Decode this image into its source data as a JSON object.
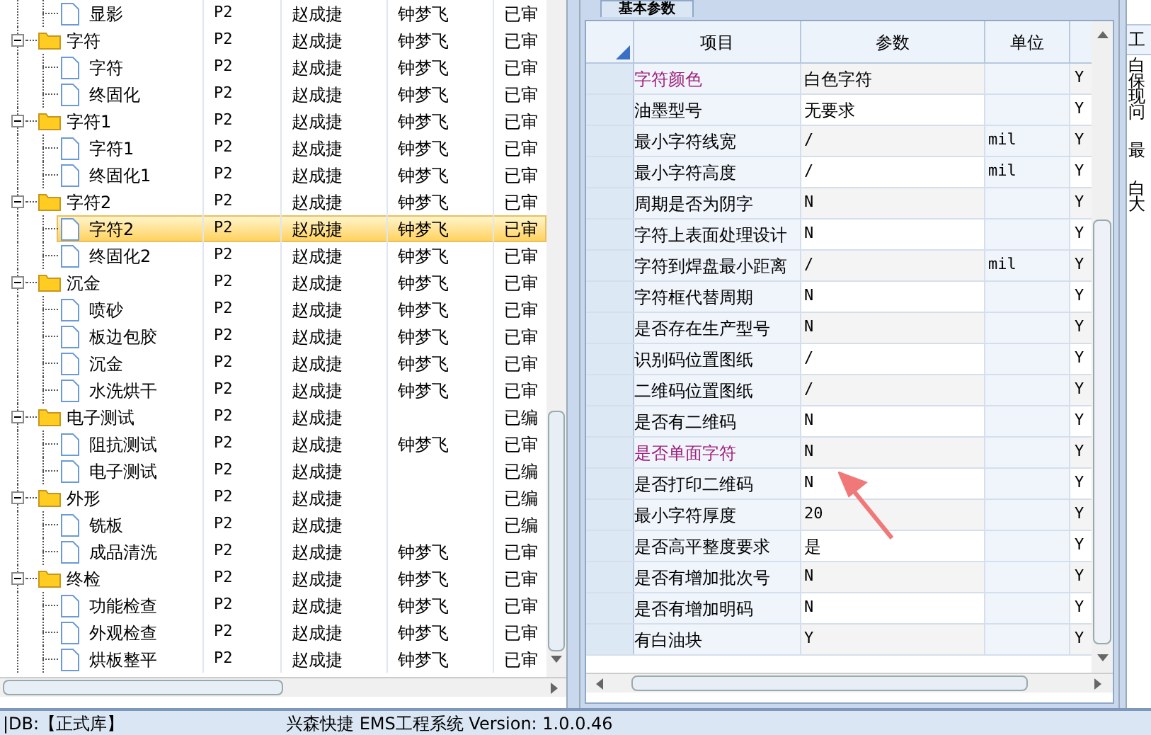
{
  "tree": {
    "nodes": [
      {
        "children": [
          {
            "label": "显影",
            "kind": "file",
            "selected": false,
            "cells": {
              "column_2": "P2",
              "column_3": "赵成捷",
              "column_4": "钟梦飞",
              "column_5": "已审"
            }
          }
        ]
      },
      {
        "label": "字符",
        "kind": "folder",
        "expanded": true,
        "selected": false,
        "cells": {
          "column_2": "P2",
          "column_3": "赵成捷",
          "column_4": "钟梦飞",
          "column_5": "已审"
        },
        "children": [
          {
            "label": "字符",
            "kind": "file",
            "selected": false,
            "cells": {
              "column_2": "P2",
              "column_3": "赵成捷",
              "column_4": "钟梦飞",
              "column_5": "已审"
            }
          },
          {
            "label": "终固化",
            "kind": "file",
            "selected": false,
            "cells": {
              "column_2": "P2",
              "column_3": "赵成捷",
              "column_4": "钟梦飞",
              "column_5": "已审"
            }
          }
        ]
      },
      {
        "label": "字符1",
        "kind": "folder",
        "expanded": true,
        "selected": false,
        "cells": {
          "column_2": "P2",
          "column_3": "赵成捷",
          "column_4": "钟梦飞",
          "column_5": "已审"
        },
        "children": [
          {
            "label": "字符1",
            "kind": "file",
            "selected": false,
            "cells": {
              "column_2": "P2",
              "column_3": "赵成捷",
              "column_4": "钟梦飞",
              "column_5": "已审"
            }
          },
          {
            "label": "终固化1",
            "kind": "file",
            "selected": false,
            "cells": {
              "column_2": "P2",
              "column_3": "赵成捷",
              "column_4": "钟梦飞",
              "column_5": "已审"
            }
          }
        ]
      },
      {
        "label": "字符2",
        "kind": "folder",
        "expanded": true,
        "selected": false,
        "cells": {
          "column_2": "P2",
          "column_3": "赵成捷",
          "column_4": "钟梦飞",
          "column_5": "已审"
        },
        "children": [
          {
            "label": "字符2",
            "kind": "file",
            "selected": true,
            "cells": {
              "column_2": "P2",
              "column_3": "赵成捷",
              "column_4": "钟梦飞",
              "column_5": "已审"
            }
          },
          {
            "label": "终固化2",
            "kind": "file",
            "selected": false,
            "cells": {
              "column_2": "P2",
              "column_3": "赵成捷",
              "column_4": "钟梦飞",
              "column_5": "已审"
            }
          }
        ]
      },
      {
        "label": "沉金",
        "kind": "folder",
        "expanded": true,
        "selected": false,
        "cells": {
          "column_2": "P2",
          "column_3": "赵成捷",
          "column_4": "钟梦飞",
          "column_5": "已审"
        },
        "children": [
          {
            "label": "喷砂",
            "kind": "file",
            "selected": false,
            "cells": {
              "column_2": "P2",
              "column_3": "赵成捷",
              "column_4": "钟梦飞",
              "column_5": "已审"
            }
          },
          {
            "label": "板边包胶",
            "kind": "file",
            "selected": false,
            "cells": {
              "column_2": "P2",
              "column_3": "赵成捷",
              "column_4": "钟梦飞",
              "column_5": "已审"
            }
          },
          {
            "label": "沉金",
            "kind": "file",
            "selected": false,
            "cells": {
              "column_2": "P2",
              "column_3": "赵成捷",
              "column_4": "钟梦飞",
              "column_5": "已审"
            }
          },
          {
            "label": "水洗烘干",
            "kind": "file",
            "selected": false,
            "cells": {
              "column_2": "P2",
              "column_3": "赵成捷",
              "column_4": "钟梦飞",
              "column_5": "已审"
            }
          }
        ]
      },
      {
        "label": "电子测试",
        "kind": "folder",
        "expanded": true,
        "selected": false,
        "cells": {
          "column_2": "P2",
          "column_3": "赵成捷",
          "column_5": "已编"
        },
        "children": [
          {
            "label": "阻抗测试",
            "kind": "file",
            "selected": false,
            "cells": {
              "column_2": "P2",
              "column_3": "赵成捷",
              "column_4": "钟梦飞",
              "column_5": "已审"
            }
          },
          {
            "label": "电子测试",
            "kind": "file",
            "selected": false,
            "cells": {
              "column_2": "P2",
              "column_3": "赵成捷",
              "column_5": "已编"
            }
          }
        ]
      },
      {
        "label": "外形",
        "kind": "folder",
        "expanded": true,
        "selected": false,
        "cells": {
          "column_2": "P2",
          "column_3": "赵成捷",
          "column_5": "已编"
        },
        "children": [
          {
            "label": "铣板",
            "kind": "file",
            "selected": false,
            "cells": {
              "column_2": "P2",
              "column_3": "赵成捷",
              "column_5": "已编"
            }
          },
          {
            "label": "成品清洗",
            "kind": "file",
            "selected": false,
            "cells": {
              "column_2": "P2",
              "column_3": "赵成捷",
              "column_4": "钟梦飞",
              "column_5": "已审"
            }
          }
        ]
      },
      {
        "label": "终检",
        "kind": "folder",
        "expanded": true,
        "selected": false,
        "cells": {
          "column_2": "P2",
          "column_3": "赵成捷",
          "column_4": "钟梦飞",
          "column_5": "已审"
        },
        "children": [
          {
            "label": "功能检查",
            "kind": "file",
            "selected": false,
            "cells": {
              "column_2": "P2",
              "column_3": "赵成捷",
              "column_4": "钟梦飞",
              "column_5": "已审"
            }
          },
          {
            "label": "外观检查",
            "kind": "file",
            "selected": false,
            "cells": {
              "column_2": "P2",
              "column_3": "赵成捷",
              "column_4": "钟梦飞",
              "column_5": "已审"
            }
          },
          {
            "label": "烘板整平",
            "kind": "file",
            "selected": false,
            "cells": {
              "column_2": "P2",
              "column_3": "赵成捷",
              "column_4": "钟梦飞",
              "column_5": "已审"
            }
          }
        ]
      }
    ]
  },
  "params": {
    "tab": "基本参数",
    "columns": [
      "项目",
      "参数",
      "单位"
    ],
    "rows": [
      {
        "item": "字符颜色",
        "value": "白色字符",
        "column_4": "Y",
        "color": "#a0207c"
      },
      {
        "item": "油墨型号",
        "value": "无要求",
        "column_4": "Y",
        "color": "#000000"
      },
      {
        "item": "最小字符线宽",
        "value": "/",
        "unit": "mil",
        "column_4": "Y",
        "color": "#000000"
      },
      {
        "item": "最小字符高度",
        "value": "/",
        "unit": "mil",
        "column_4": "Y",
        "color": "#000000"
      },
      {
        "item": "周期是否为阴字",
        "value": "N",
        "column_4": "Y",
        "color": "#000000"
      },
      {
        "item": "字符上表面处理设计",
        "value": "N",
        "column_4": "Y",
        "color": "#000000"
      },
      {
        "item": "字符到焊盘最小距离",
        "value": "/",
        "unit": "mil",
        "column_4": "Y",
        "color": "#000000"
      },
      {
        "item": "字符框代替周期",
        "value": "N",
        "column_4": "Y",
        "color": "#000000"
      },
      {
        "item": "是否存在生产型号",
        "value": "N",
        "column_4": "Y",
        "color": "#000000"
      },
      {
        "item": "识别码位置图纸",
        "value": "/",
        "column_4": "Y",
        "color": "#000000"
      },
      {
        "item": "二维码位置图纸",
        "value": "/",
        "column_4": "Y",
        "color": "#000000"
      },
      {
        "item": "是否有二维码",
        "value": "N",
        "column_4": "Y",
        "color": "#000000"
      },
      {
        "item": "是否单面字符",
        "value": "N",
        "column_4": "Y",
        "color": "#a0207c"
      },
      {
        "item": "是否打印二维码",
        "value": "N",
        "column_4": "Y",
        "color": "#000000"
      },
      {
        "item": "最小字符厚度",
        "value": "20",
        "column_4": "Y",
        "color": "#000000"
      },
      {
        "item": "是否高平整度要求",
        "value": "是",
        "column_4": "Y",
        "color": "#000000"
      },
      {
        "item": "是否有增加批次号",
        "value": "N",
        "column_4": "Y",
        "color": "#000000"
      },
      {
        "item": "是否有增加明码",
        "value": "N",
        "column_4": "Y",
        "color": "#000000"
      },
      {
        "item": "有白油块",
        "value": "Y",
        "column_4": "Y",
        "color": "#000000"
      }
    ]
  },
  "side_panel": {
    "header": "工",
    "lines": [
      "白",
      "保",
      "现",
      "问",
      "最",
      "白",
      "大"
    ]
  },
  "status_bar": {
    "db": "|DB:【正式库】",
    "app": "兴森快捷 EMS工程系统 Version: 1.0.0.46"
  }
}
